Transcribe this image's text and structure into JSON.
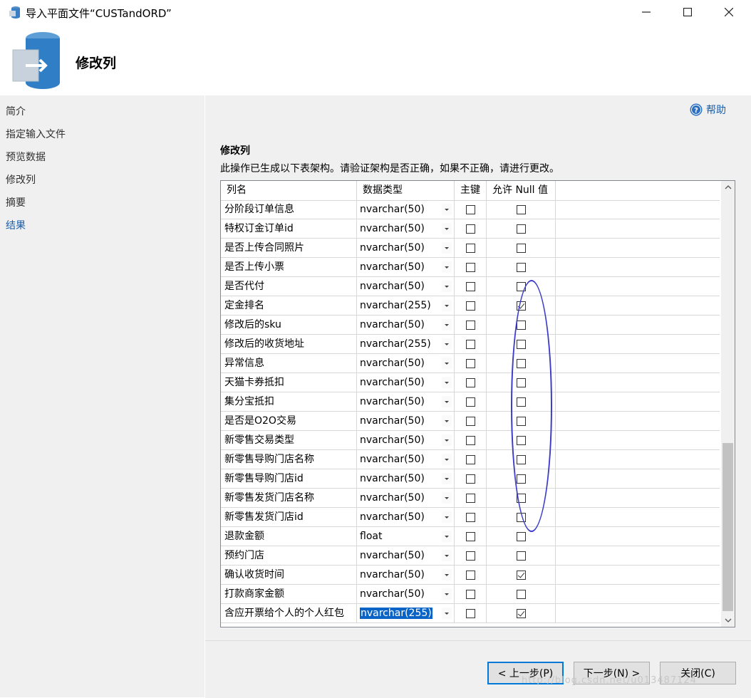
{
  "window": {
    "title": "导入平面文件“CUSTandORD”",
    "minimize_icon": "minimize-icon",
    "maximize_icon": "maximize-icon",
    "close_icon": "close-icon"
  },
  "header": {
    "title": "修改列",
    "icon": "database-import-icon"
  },
  "nav": {
    "items": [
      {
        "label": "简介"
      },
      {
        "label": "指定输入文件"
      },
      {
        "label": "预览数据"
      },
      {
        "label": "修改列"
      },
      {
        "label": "摘要"
      },
      {
        "label": "结果",
        "active": true
      }
    ]
  },
  "help": {
    "label": "帮助",
    "icon": "help-icon"
  },
  "section": {
    "title": "修改列",
    "description": "此操作已生成以下表架构。请验证架构是否正确，如果不正确，请进行更改。"
  },
  "grid": {
    "columns": [
      "列名",
      "数据类型",
      "主键",
      "允许 Null 值"
    ],
    "rows": [
      {
        "name": "分阶段订单信息",
        "type": "nvarchar(50)",
        "pk": false,
        "nullable": false
      },
      {
        "name": "特权订金订单id",
        "type": "nvarchar(50)",
        "pk": false,
        "nullable": false
      },
      {
        "name": "是否上传合同照片",
        "type": "nvarchar(50)",
        "pk": false,
        "nullable": false
      },
      {
        "name": "是否上传小票",
        "type": "nvarchar(50)",
        "pk": false,
        "nullable": false
      },
      {
        "name": "是否代付",
        "type": "nvarchar(50)",
        "pk": false,
        "nullable": false
      },
      {
        "name": "定金排名",
        "type": "nvarchar(255)",
        "pk": false,
        "nullable": true
      },
      {
        "name": "修改后的sku",
        "type": "nvarchar(50)",
        "pk": false,
        "nullable": false
      },
      {
        "name": "修改后的收货地址",
        "type": "nvarchar(255)",
        "pk": false,
        "nullable": false
      },
      {
        "name": "异常信息",
        "type": "nvarchar(50)",
        "pk": false,
        "nullable": false
      },
      {
        "name": "天猫卡券抵扣",
        "type": "nvarchar(50)",
        "pk": false,
        "nullable": false
      },
      {
        "name": "集分宝抵扣",
        "type": "nvarchar(50)",
        "pk": false,
        "nullable": false
      },
      {
        "name": "是否是O2O交易",
        "type": "nvarchar(50)",
        "pk": false,
        "nullable": false
      },
      {
        "name": "新零售交易类型",
        "type": "nvarchar(50)",
        "pk": false,
        "nullable": false
      },
      {
        "name": "新零售导购门店名称",
        "type": "nvarchar(50)",
        "pk": false,
        "nullable": false
      },
      {
        "name": "新零售导购门店id",
        "type": "nvarchar(50)",
        "pk": false,
        "nullable": false
      },
      {
        "name": "新零售发货门店名称",
        "type": "nvarchar(50)",
        "pk": false,
        "nullable": false
      },
      {
        "name": "新零售发货门店id",
        "type": "nvarchar(50)",
        "pk": false,
        "nullable": false
      },
      {
        "name": "退款金额",
        "type": "float",
        "pk": false,
        "nullable": false
      },
      {
        "name": "预约门店",
        "type": "nvarchar(50)",
        "pk": false,
        "nullable": false
      },
      {
        "name": "确认收货时间",
        "type": "nvarchar(50)",
        "pk": false,
        "nullable": true
      },
      {
        "name": "打款商家金额",
        "type": "nvarchar(50)",
        "pk": false,
        "nullable": false
      },
      {
        "name": "含应开票给个人的个人红包",
        "type": "nvarchar(255)",
        "pk": false,
        "nullable": true,
        "selected": true
      }
    ]
  },
  "footer": {
    "back_label": "< 上一步(P)",
    "next_label": "下一步(N) >",
    "close_label": "关闭(C)",
    "watermark": "http://blog.csdn.net/u013487124"
  },
  "colors": {
    "accent": "#1a5ea9",
    "selection": "#0a64c8",
    "annotation": "#3c3cc8"
  }
}
